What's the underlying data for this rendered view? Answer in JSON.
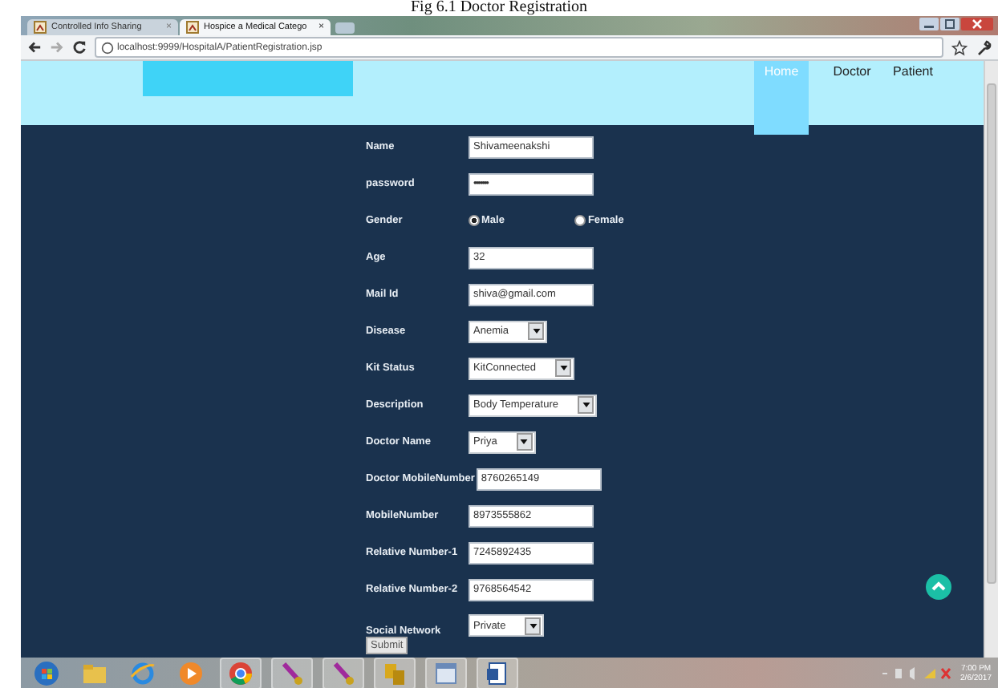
{
  "caption": "Fig 6.1 Doctor Registration",
  "browser": {
    "tabs": [
      {
        "title": "Controlled Info Sharing",
        "close": "×",
        "selected": false
      },
      {
        "title": "Hospice a Medical Catego",
        "close": "×",
        "selected": true
      }
    ],
    "url": "localhost:9999/HospitalA/PatientRegistration.jsp"
  },
  "header": {
    "nav": [
      {
        "label": "Home",
        "selected": true
      },
      {
        "label": "Doctor",
        "selected": false
      },
      {
        "label": "Patient",
        "selected": false
      }
    ]
  },
  "form": {
    "fields": [
      {
        "kind": "text",
        "label": "Name",
        "value": "Shivameenakshi"
      },
      {
        "kind": "password",
        "label": "password",
        "value": "•••••••"
      },
      {
        "kind": "radio",
        "label": "Gender",
        "options": [
          {
            "label": "Male",
            "selected": true
          },
          {
            "label": "Female",
            "selected": false
          }
        ]
      },
      {
        "kind": "text",
        "label": "Age",
        "value": "32"
      },
      {
        "kind": "text",
        "label": "Mail Id",
        "value": "shiva@gmail.com"
      },
      {
        "kind": "select",
        "label": "Disease",
        "value": "Anemia"
      },
      {
        "kind": "select",
        "label": "Kit Status",
        "value": "KitConnected"
      },
      {
        "kind": "select",
        "label": "Description",
        "value": "Body Temperature"
      },
      {
        "kind": "select",
        "label": "Doctor Name",
        "value": "Priya"
      },
      {
        "kind": "text",
        "label": "Doctor MobileNumber",
        "value": "8760265149"
      },
      {
        "kind": "text",
        "label": "MobileNumber",
        "value": "8973555862"
      },
      {
        "kind": "text",
        "label": "Relative Number-1",
        "value": "7245892435"
      },
      {
        "kind": "text",
        "label": "Relative Number-2",
        "value": "9768564542"
      },
      {
        "kind": "select",
        "label": "Social Network",
        "value": "Private"
      }
    ],
    "submit": "Submit"
  },
  "taskbar": {
    "time": "7:00 PM",
    "date": "2/6/2017"
  }
}
